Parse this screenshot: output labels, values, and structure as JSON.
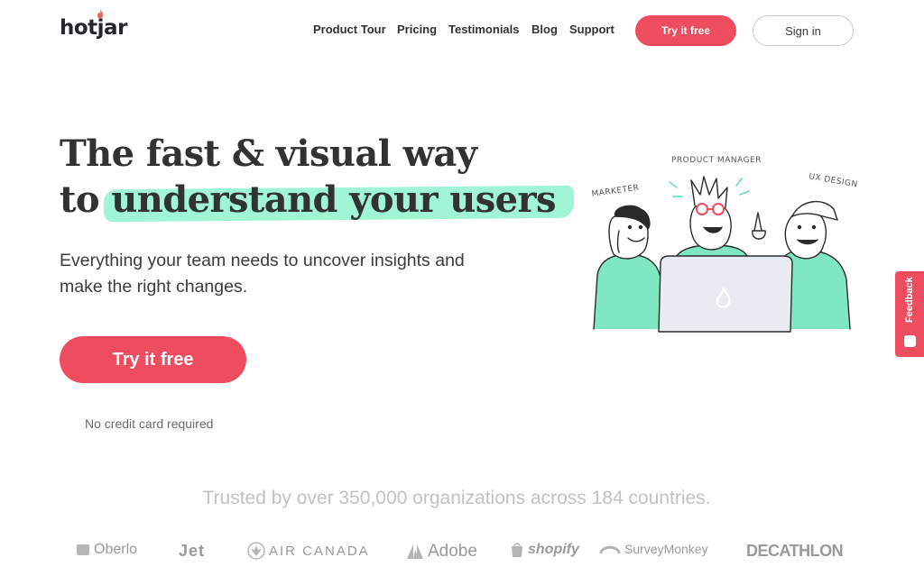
{
  "header": {
    "logo": "hotjar",
    "nav": [
      "Product Tour",
      "Pricing",
      "Testimonials",
      "Blog",
      "Support"
    ],
    "try_label": "Try it free",
    "signin_label": "Sign in"
  },
  "hero": {
    "headline_line1": "The fast & visual way",
    "headline_to": "to",
    "headline_highlight": "understand your users",
    "subhead": "Everything your team needs to uncover insights and make the right changes.",
    "cta_label": "Try it free",
    "note": "No credit card required"
  },
  "illustration": {
    "labels": [
      "MARKETER",
      "PRODUCT MANAGER",
      "UX DESIGNER"
    ]
  },
  "feedback": {
    "label": "Feedback"
  },
  "trusted": {
    "text": "Trusted by over 350,000 organizations across 184 countries.",
    "brands": [
      "Oberlo",
      "Jet",
      "AIR CANADA",
      "Adobe",
      "shopify",
      "SurveyMonkey",
      "DECATHLON"
    ]
  },
  "colors": {
    "accent": "#ee4d5f",
    "highlight": "#8ef3cc",
    "text": "#323232"
  }
}
